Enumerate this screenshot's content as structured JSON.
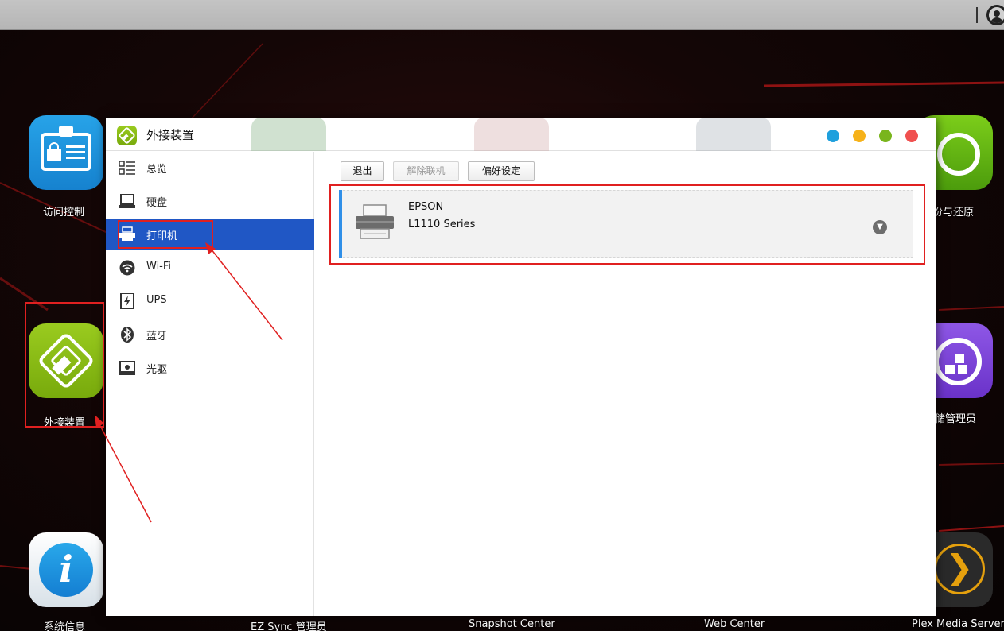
{
  "desktop": {
    "icons": [
      {
        "label": "访问控制"
      },
      {
        "label": "外接装置"
      },
      {
        "label": "系统信息"
      },
      {
        "label": "EZ Sync 管理员"
      },
      {
        "label": "Snapshot Center"
      },
      {
        "label": "Web Center"
      },
      {
        "label": "份与还原"
      },
      {
        "label": "储管理员"
      },
      {
        "label": "Plex Media Server"
      }
    ]
  },
  "window": {
    "title": "外接装置",
    "controls": {
      "colors": [
        "#1fa0dd",
        "#f6b21a",
        "#79b51c",
        "#f0504f"
      ]
    }
  },
  "sidebar": {
    "items": [
      {
        "label": "总览",
        "icon": "overview-icon"
      },
      {
        "label": "硬盘",
        "icon": "hard-disk-icon"
      },
      {
        "label": "打印机",
        "icon": "printer-icon",
        "selected": true
      },
      {
        "label": "Wi-Fi",
        "icon": "wifi-icon"
      },
      {
        "label": "UPS",
        "icon": "ups-icon"
      },
      {
        "label": "蓝牙",
        "icon": "bluetooth-icon"
      },
      {
        "label": "光驱",
        "icon": "optical-drive-icon"
      }
    ]
  },
  "toolbar": {
    "eject_label": "退出",
    "unlink_label": "解除联机",
    "preferences_label": "偏好设定"
  },
  "devices": [
    {
      "name": "EPSON",
      "model": "L1110 Series",
      "icon": "printer-icon"
    }
  ],
  "colors": {
    "selection": "#2057c5",
    "accent": "#2f8fe8",
    "annotation": "#e02020"
  }
}
